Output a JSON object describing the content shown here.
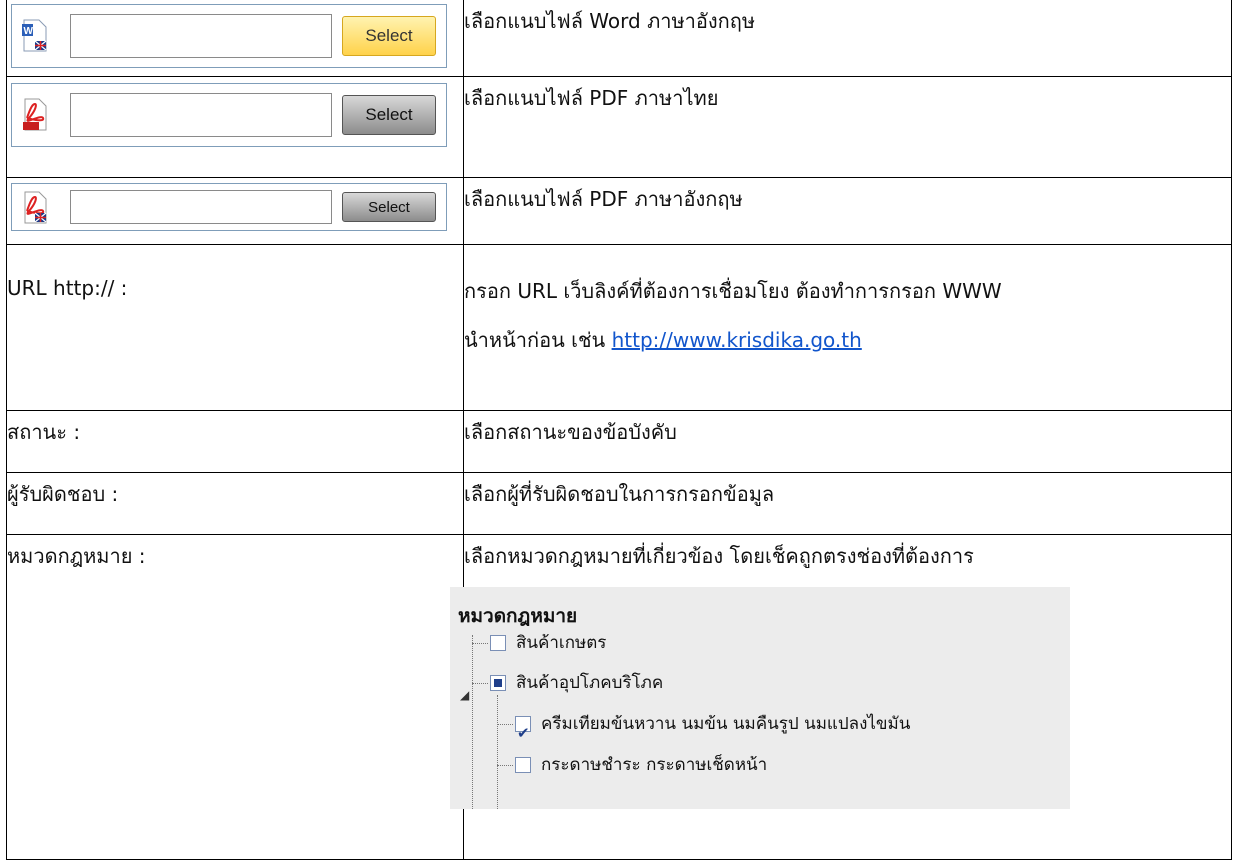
{
  "uploads": [
    {
      "select_label": "Select",
      "icon": "word-english-file-icon",
      "description": "เลือกแนบไฟล์ Word ภาษาอังกฤษ",
      "button_color": "#ffd24a"
    },
    {
      "select_label": "Select",
      "icon": "pdf-file-icon",
      "description": "เลือกแนบไฟล์ PDF ภาษาไทย",
      "button_color": "#8c8c8c"
    },
    {
      "select_label": "Select",
      "icon": "pdf-english-file-icon",
      "description": "เลือกแนบไฟล์ PDF ภาษาอังกฤษ",
      "button_color": "#8c8c8c"
    }
  ],
  "fields": [
    {
      "label": "URL http:// :",
      "desc_line1": "กรอก URL เว็บลิงค์ที่ต้องการเชื่อมโยง ต้องทำการกรอก WWW",
      "desc_line2": "นำหน้าก่อน เช่น ",
      "link": "http://www.krisdika.go.th"
    },
    {
      "label": "สถานะ :",
      "desc": "เลือกสถานะของข้อบังคับ"
    },
    {
      "label": "ผู้รับผิดชอบ :",
      "desc": "เลือกผู้ที่รับผิดชอบในการกรอกข้อมูล"
    },
    {
      "label": "หมวดกฎหมาย :",
      "desc": "เลือกหมวดกฎหมายที่เกี่ยวข้อง โดยเช็คถูกตรงช่องที่ต้องการ"
    }
  ],
  "tree": {
    "title": "หมวดกฎหมาย",
    "items": [
      {
        "label": "สินค้าเกษตร",
        "state": "unchecked"
      },
      {
        "label": "สินค้าอุปโภคบริโภค",
        "state": "partial"
      },
      {
        "label": "ครีมเทียมข้นหวาน นมข้น นมคืนรูป นมแปลงไขมัน",
        "state": "checked"
      },
      {
        "label": "กระดาษชำระ กระดาษเช็ดหน้า",
        "state": "unchecked"
      }
    ]
  },
  "colors": {
    "link": "#1155cc",
    "tree_bg": "#ececec",
    "checkbox_mark": "#1f3f8a"
  }
}
